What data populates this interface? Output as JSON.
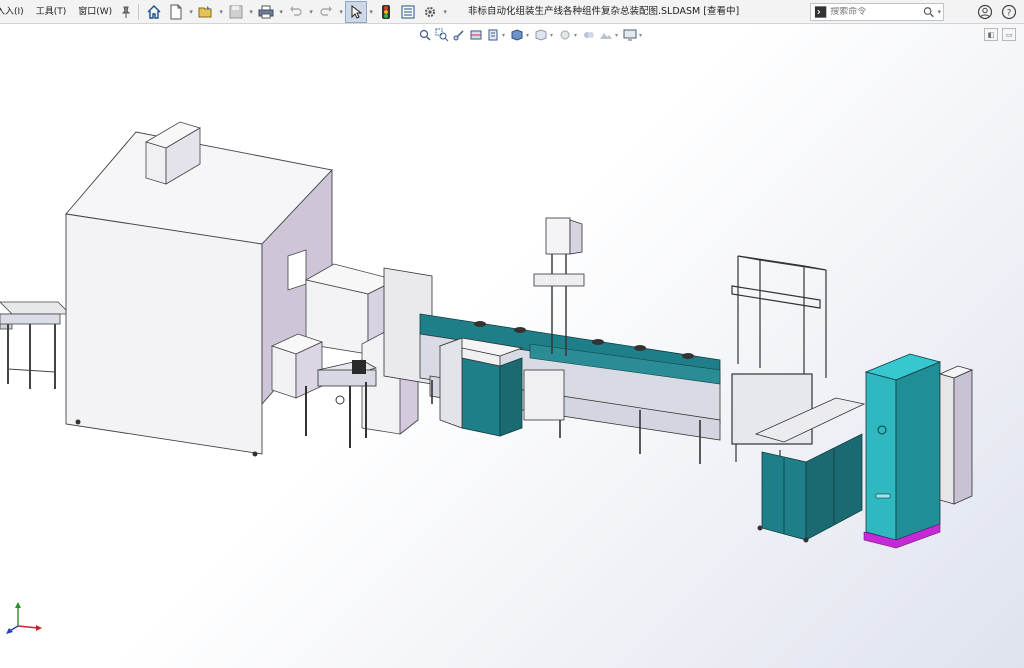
{
  "menu": {
    "items": [
      {
        "label": "入入(I)"
      },
      {
        "label": "工具(T)"
      },
      {
        "label": "窗口(W)"
      }
    ]
  },
  "window": {
    "title": "非标自动化组装生产线各种组件复杂总装配图.SLDASM [查看中]"
  },
  "search": {
    "placeholder": "搜索命令"
  },
  "toolbar": {
    "icons": [
      "home-icon",
      "new-document-icon",
      "open-folder-icon",
      "save-icon",
      "print-icon",
      "undo-icon",
      "redo-icon",
      "select-arrow-icon",
      "traffic-light-icon",
      "file-properties-icon",
      "options-gear-icon"
    ]
  },
  "heads_up": {
    "icons": [
      "zoom-to-fit-icon",
      "zoom-area-icon",
      "previous-view-icon",
      "section-view-icon",
      "dynamic-annotation-icon",
      "view-orientation-icon",
      "display-style-icon",
      "hide-show-icon",
      "edit-appearance-icon",
      "apply-scene-icon",
      "view-settings-icon"
    ]
  },
  "colors": {
    "accent": "#1d6fb8",
    "machine_teal": "#1f7f88",
    "cabinet_cyan": "#2fb8c0",
    "housing_white": "#f4f4f6",
    "magenta_base": "#c62ad8"
  }
}
